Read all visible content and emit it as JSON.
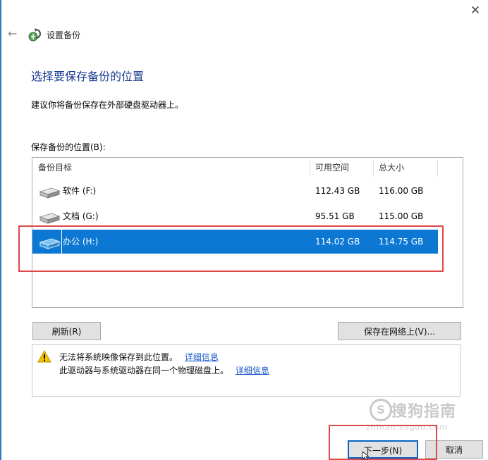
{
  "window": {
    "title": "设置备份",
    "close_glyph": "✕",
    "back_glyph": "←"
  },
  "page": {
    "heading": "选择要保存备份的位置",
    "description": "建议你将备份保存在外部硬盘驱动器上。",
    "location_label": "保存备份的位置(B):"
  },
  "table": {
    "columns": [
      "备份目标",
      "可用空间",
      "总大小"
    ],
    "rows": [
      {
        "name": "软件 (F:)",
        "free": "112.43 GB",
        "total": "116.00 GB",
        "selected": false
      },
      {
        "name": "文档 (G:)",
        "free": "95.51 GB",
        "total": "115.00 GB",
        "selected": false
      },
      {
        "name": "办公 (H:)",
        "free": "114.02 GB",
        "total": "114.75 GB",
        "selected": true
      }
    ]
  },
  "buttons": {
    "refresh": "刷新(R)",
    "save_network": "保存在网络上(V)...",
    "next": "下一步(N)",
    "cancel": "取消"
  },
  "message": {
    "line1": "无法将系统映像保存到此位置。",
    "line1_link": "详细信息",
    "line2": "此驱动器与系统驱动器在同一个物理磁盘上。",
    "line2_link": "详细信息"
  },
  "watermark": {
    "symbol": "S",
    "text": "搜狗指南",
    "url": "zhinan.sogou.com"
  },
  "colors": {
    "selection": "#0d78d4",
    "heading": "#1a3c92",
    "link": "#1a58c8",
    "highlight_box": "#e04848",
    "warning": "#f5c400"
  }
}
